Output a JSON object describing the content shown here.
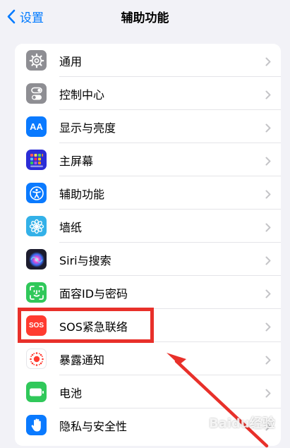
{
  "nav": {
    "back_label": "设置",
    "title": "辅助功能"
  },
  "colors": {
    "accent": "#007aff",
    "highlight": "#e8302a"
  },
  "settings_items": [
    {
      "label": "通用",
      "icon": "gear-icon"
    },
    {
      "label": "控制中心",
      "icon": "toggles-icon"
    },
    {
      "label": "显示与亮度",
      "icon": "text-size-icon",
      "icon_text": "AA"
    },
    {
      "label": "主屏幕",
      "icon": "app-grid-icon"
    },
    {
      "label": "辅助功能",
      "icon": "accessibility-icon"
    },
    {
      "label": "墙纸",
      "icon": "flower-icon"
    },
    {
      "label": "Siri与搜索",
      "icon": "siri-icon"
    },
    {
      "label": "面容ID与密码",
      "icon": "face-id-icon"
    },
    {
      "label": "SOS紧急联络",
      "icon": "sos-icon",
      "icon_text": "SOS"
    },
    {
      "label": "暴露通知",
      "icon": "exposure-icon"
    },
    {
      "label": "电池",
      "icon": "battery-icon"
    },
    {
      "label": "隐私与安全性",
      "icon": "hand-icon"
    }
  ],
  "watermark": "Baidu经验"
}
